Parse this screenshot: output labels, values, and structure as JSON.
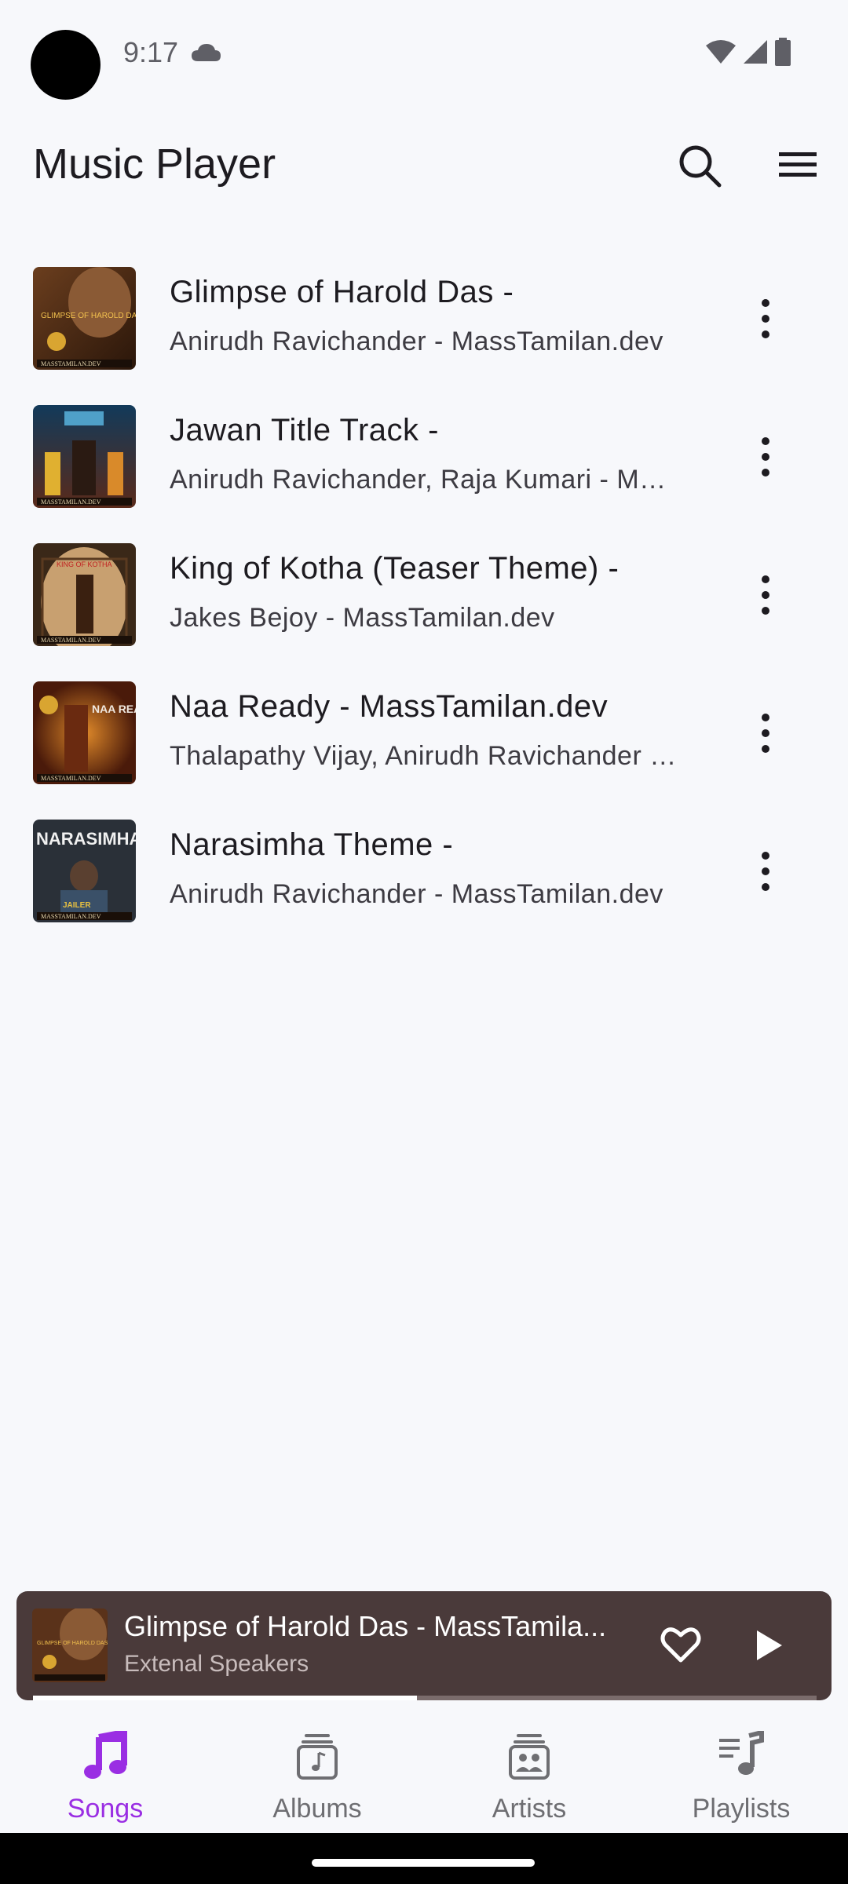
{
  "status_bar": {
    "time": "9:17",
    "icons": [
      "cloud-icon",
      "wifi-icon",
      "signal-icon",
      "battery-icon"
    ]
  },
  "app_bar": {
    "title": "Music Player",
    "actions": [
      "search-icon",
      "menu-icon"
    ]
  },
  "songs": [
    {
      "title": "Glimpse of Harold Das -",
      "subtitle": "Anirudh Ravichander - MassTamilan.dev"
    },
    {
      "title": "Jawan Title Track -",
      "subtitle": "Anirudh Ravichander, Raja Kumari - MassTamilan.dev"
    },
    {
      "title": "King of Kotha (Teaser Theme) -",
      "subtitle": "Jakes Bejoy - MassTamilan.dev"
    },
    {
      "title": "Naa Ready - MassTamilan.dev",
      "subtitle": "Thalapathy Vijay, Anirudh Ravichander - MassTamilan.dev"
    },
    {
      "title": "Narasimha Theme -",
      "subtitle": "Anirudh Ravichander - MassTamilan.dev"
    }
  ],
  "cover_text": {
    "c0": "GLIMPSE OF HAROLD DAS",
    "c2": "KING OF KOTHA",
    "c3": "NAA READY",
    "c4": "NARASIMHA",
    "c4b": "JAILER",
    "watermark": "MASSTAMILAN.DEV"
  },
  "mini_player": {
    "title": "Glimpse of Harold Das - MassTamila...",
    "subtitle": "Extenal Speakers",
    "progress": 0.49
  },
  "bottom_nav": {
    "items": [
      {
        "label": "Songs",
        "icon": "music-note-icon",
        "active": true
      },
      {
        "label": "Albums",
        "icon": "album-icon",
        "active": false
      },
      {
        "label": "Artists",
        "icon": "artist-icon",
        "active": false
      },
      {
        "label": "Playlists",
        "icon": "playlist-icon",
        "active": false
      }
    ]
  },
  "colors": {
    "background": "#f7f8fb",
    "accent": "#9a2ee3",
    "mini_player_bg": "#4a3a3a"
  }
}
